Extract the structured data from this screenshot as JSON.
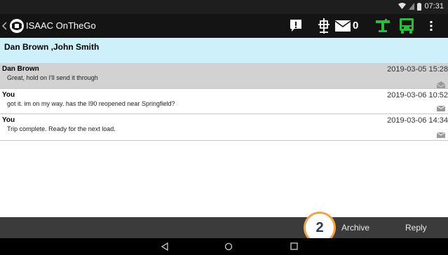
{
  "status": {
    "time": "07:31"
  },
  "appbar": {
    "title": "ISAAC OnTheGo",
    "message_count": "0",
    "colors": {
      "wifi_icon": "#2dbb3a",
      "truck_icon": "#2dbb3a"
    }
  },
  "conversation": {
    "participants": "Dan Brown ,John Smith"
  },
  "messages": [
    {
      "from": "Dan Brown",
      "body": "Great, hold on I'll send it through",
      "time": "2019-03-05 15:28",
      "highlighted": true
    },
    {
      "from": "You",
      "body": "got it. im on my way. has the I90 reopened near Springfield?",
      "time": "2019-03-06 10:52",
      "highlighted": false
    },
    {
      "from": "You",
      "body": "Trip complete. Ready for the next load.",
      "time": "2019-03-06 14:34",
      "highlighted": false
    }
  ],
  "actions": {
    "badge_number": "2",
    "archive_label": "Archive",
    "reply_label": "Reply"
  },
  "icons": [
    "back-icon",
    "app-logo-icon",
    "alert-icon",
    "gps-icon",
    "envelope-icon",
    "hotspot-icon",
    "truck-icon",
    "overflow-menu-icon",
    "wifi-icon",
    "signal-icon",
    "battery-icon",
    "read-envelope-icon",
    "nav-back-icon",
    "nav-home-icon",
    "nav-recents-icon"
  ]
}
